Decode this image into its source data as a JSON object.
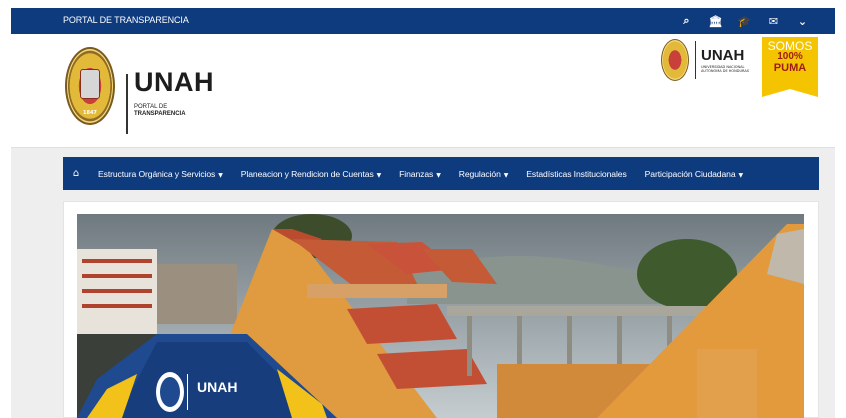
{
  "topbar": {
    "label": "PORTAL DE TRANSPARENCIA",
    "icons": [
      "search-icon",
      "bank-icon",
      "graduation-cap-icon",
      "envelope-icon",
      "chevron-down-icon"
    ]
  },
  "header": {
    "brand_name": "UNAH",
    "brand_sub_1": "PORTAL DE",
    "brand_sub_2": "TRANSPARENCIA",
    "seal_year": "1847",
    "right_logo_name": "UNAH",
    "right_logo_sub": "UNIVERSIDAD NACIONAL AUTÓNOMA DE HONDURAS",
    "puma_line1": "SOMOS",
    "puma_line2": "100%",
    "puma_line3": "PUMA"
  },
  "nav": {
    "items": [
      {
        "label": "Estructura Orgánica y Servicios",
        "dropdown": true
      },
      {
        "label": "Planeacion y Rendicion de Cuentas",
        "dropdown": true
      },
      {
        "label": "Finanzas",
        "dropdown": true
      },
      {
        "label": "Regulación",
        "dropdown": true
      },
      {
        "label": "Estadísticas Institucionales",
        "dropdown": false
      },
      {
        "label": "Participación Ciudadana",
        "dropdown": true
      }
    ]
  },
  "hero": {
    "badge_name": "UNAH"
  },
  "colors": {
    "primary": "#0e3a7e",
    "accent": "#f5c400",
    "puma_red": "#9e1b1b"
  }
}
